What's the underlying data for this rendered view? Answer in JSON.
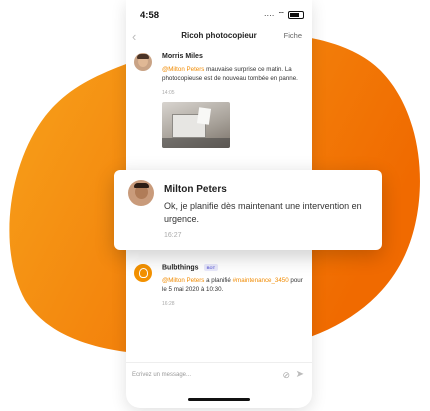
{
  "colors": {
    "accent": "#f08a00",
    "blob_light": "#f7a21b",
    "blob_dark": "#f06a00"
  },
  "status_bar": {
    "time": "4:58"
  },
  "nav": {
    "title": "Ricoh photocopieur",
    "right_link": "Fiche",
    "back_icon": "chevron-left-icon"
  },
  "messages": [
    {
      "author": "Morris Miles",
      "mention": "@Milton Peters",
      "text": " mauvaise surprise ce matin. La photocopieuse est de nouveau tombée en panne.",
      "time": "14:05",
      "attachment": "photo"
    },
    {
      "author": "Bulbthings",
      "badge": "BOT",
      "mention": "@Milton Peters",
      "text_before_tag": " a planifié ",
      "tag": "#maintenance_3450",
      "text_after_tag": " pour le 5 mai 2020 à 10:30.",
      "time": "16:28"
    }
  ],
  "highlight_card": {
    "author": "Milton Peters",
    "text": "Ok, je planifie dès maintenant une intervention en urgence.",
    "time": "16:27"
  },
  "composer": {
    "placeholder": "Ecrivez un message..."
  }
}
